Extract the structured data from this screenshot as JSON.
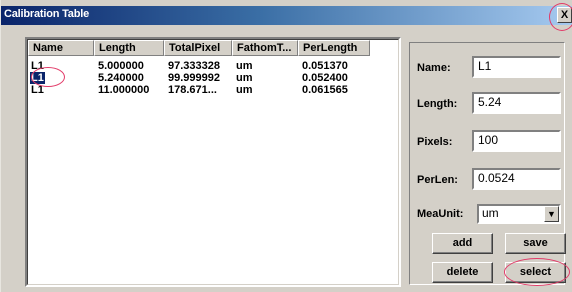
{
  "window": {
    "title": "Calibration Table",
    "close_glyph": "X"
  },
  "table": {
    "columns": [
      "Name",
      "Length",
      "TotalPixel",
      "FathomT...",
      "PerLength"
    ],
    "rows": [
      [
        "L1",
        "5.000000",
        "97.333328",
        "um",
        "0.051370"
      ],
      [
        "L1",
        "5.240000",
        "99.999992",
        "um",
        "0.052400"
      ],
      [
        "L1",
        "11.000000",
        "178.671...",
        "um",
        "0.061565"
      ]
    ],
    "selected_row": 1
  },
  "form": {
    "name_label": "Name:",
    "name_value": "L1",
    "length_label": "Length:",
    "length_value": "5.24",
    "pixels_label": "Pixels:",
    "pixels_value": "100",
    "perlen_label": "PerLen:",
    "perlen_value": "0.0524",
    "meaunit_label": "MeaUnit:",
    "meaunit_value": "um"
  },
  "buttons": {
    "add": "add",
    "save": "save",
    "delete": "delete",
    "select": "select"
  },
  "colors": {
    "highlight": "#0a246a",
    "annotation_circle": "#e23a68"
  },
  "icons": {
    "combo_arrow": "chevron-down-icon",
    "close": "close-icon"
  }
}
